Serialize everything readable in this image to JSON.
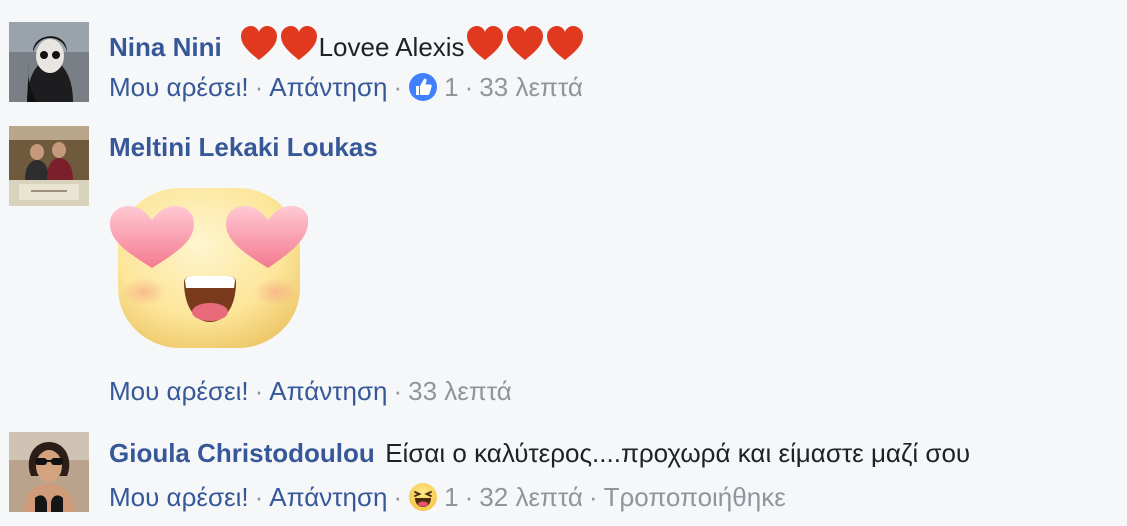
{
  "comments": [
    {
      "author": "Nina Nini",
      "text_before_hearts": "",
      "text_middle": "Lovee Alexis",
      "like_label": "Μου αρέσει!",
      "reply_label": "Απάντηση",
      "reaction_count": "1",
      "time": "33 λεπτά",
      "reaction_icon": "like-icon"
    },
    {
      "author": "Meltini Lekaki Loukas",
      "sticker": "heart-eyes-sticker",
      "like_label": "Μου αρέσει!",
      "reply_label": "Απάντηση",
      "time": "33 λεπτά"
    },
    {
      "author": "Gioula Christodoulou",
      "text": "Είσαι ο καλύτερος....προχωρά και είμαστε μαζί σου",
      "like_label": "Μου αρέσει!",
      "reply_label": "Απάντηση",
      "reaction_count": "1",
      "time": "32 λεπτά",
      "edited_label": "Τροποποιήθηκε",
      "reaction_icon": "haha-icon"
    }
  ],
  "colors": {
    "background": "#f6f7f9",
    "author": "#365899",
    "link": "#365899",
    "meta": "#90949c",
    "text": "#1d2129",
    "heart": "#e0391f",
    "like_blue": "#4080ff"
  }
}
